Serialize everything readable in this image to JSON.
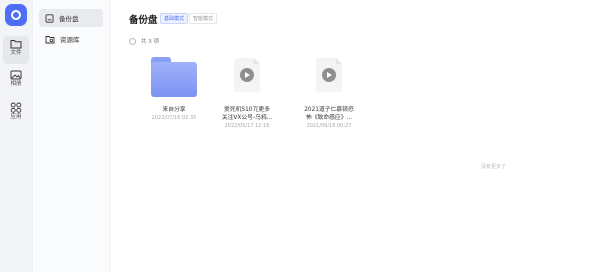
{
  "rail": {
    "items": [
      {
        "label": "文件",
        "icon": "folder-icon",
        "active": true
      },
      {
        "label": "相册",
        "icon": "photo-icon",
        "active": false
      },
      {
        "label": "应用",
        "icon": "apps-icon",
        "active": false
      }
    ]
  },
  "sidebar": {
    "items": [
      {
        "label": "备份盘",
        "icon": "backup-drive-icon",
        "active": true
      },
      {
        "label": "资源库",
        "icon": "resource-library-icon",
        "active": false
      }
    ]
  },
  "main": {
    "title": "备份盘",
    "modes": [
      "基础模式",
      "智能模式"
    ],
    "select_count": "共 3 项",
    "files": [
      {
        "name_line1": "来自分享",
        "name_line2": "",
        "date": "2022/07/16 02:35",
        "type": "folder"
      },
      {
        "name_line1": "爱死机S107[更多",
        "name_line2": "关注VX公号-乌鸦...",
        "date": "2022/05/17 12:16",
        "type": "video"
      },
      {
        "name_line1": "2021道子仁慕顿恐",
        "name_line2": "怖《致命感应》...",
        "date": "2021/09/18 00:27",
        "type": "video"
      }
    ],
    "no_more": "没有更多了"
  },
  "colors": {
    "accent": "#4f6ef7",
    "folder": "#8a9ef6"
  }
}
